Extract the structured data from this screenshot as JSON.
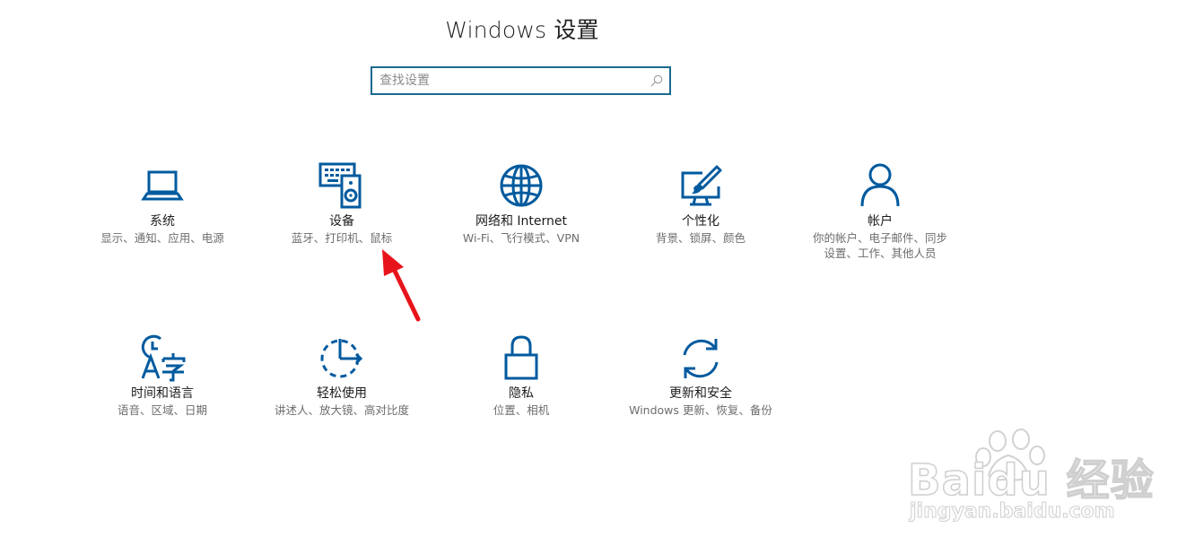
{
  "window": {
    "title": "Windows 设置"
  },
  "search": {
    "placeholder": "查找设置",
    "value": ""
  },
  "tiles": [
    {
      "name": "系统",
      "desc": "显示、通知、应用、电源",
      "icon": "laptop-icon"
    },
    {
      "name": "设备",
      "desc": "蓝牙、打印机、鼠标",
      "icon": "devices-icon"
    },
    {
      "name": "网络和 Internet",
      "desc": "Wi-Fi、飞行模式、VPN",
      "icon": "globe-icon"
    },
    {
      "name": "个性化",
      "desc": "背景、锁屏、颜色",
      "icon": "personalization-icon"
    },
    {
      "name": "帐户",
      "desc": "你的帐户、电子邮件、同步设置、工作、其他人员",
      "icon": "person-icon"
    },
    {
      "name": "时间和语言",
      "desc": "语音、区域、日期",
      "icon": "time-language-icon"
    },
    {
      "name": "轻松使用",
      "desc": "讲述人、放大镜、高对比度",
      "icon": "ease-of-access-icon"
    },
    {
      "name": "隐私",
      "desc": "位置、相机",
      "icon": "lock-icon"
    },
    {
      "name": "更新和安全",
      "desc": "Windows 更新、恢复、备份",
      "icon": "update-icon"
    }
  ],
  "watermark": {
    "brand": "Baidu 经验",
    "url": "jingyan.baidu.com"
  },
  "colors": {
    "accent": "#005a9e",
    "search_border": "#1a6a8c",
    "arrow": "#e8141b"
  }
}
